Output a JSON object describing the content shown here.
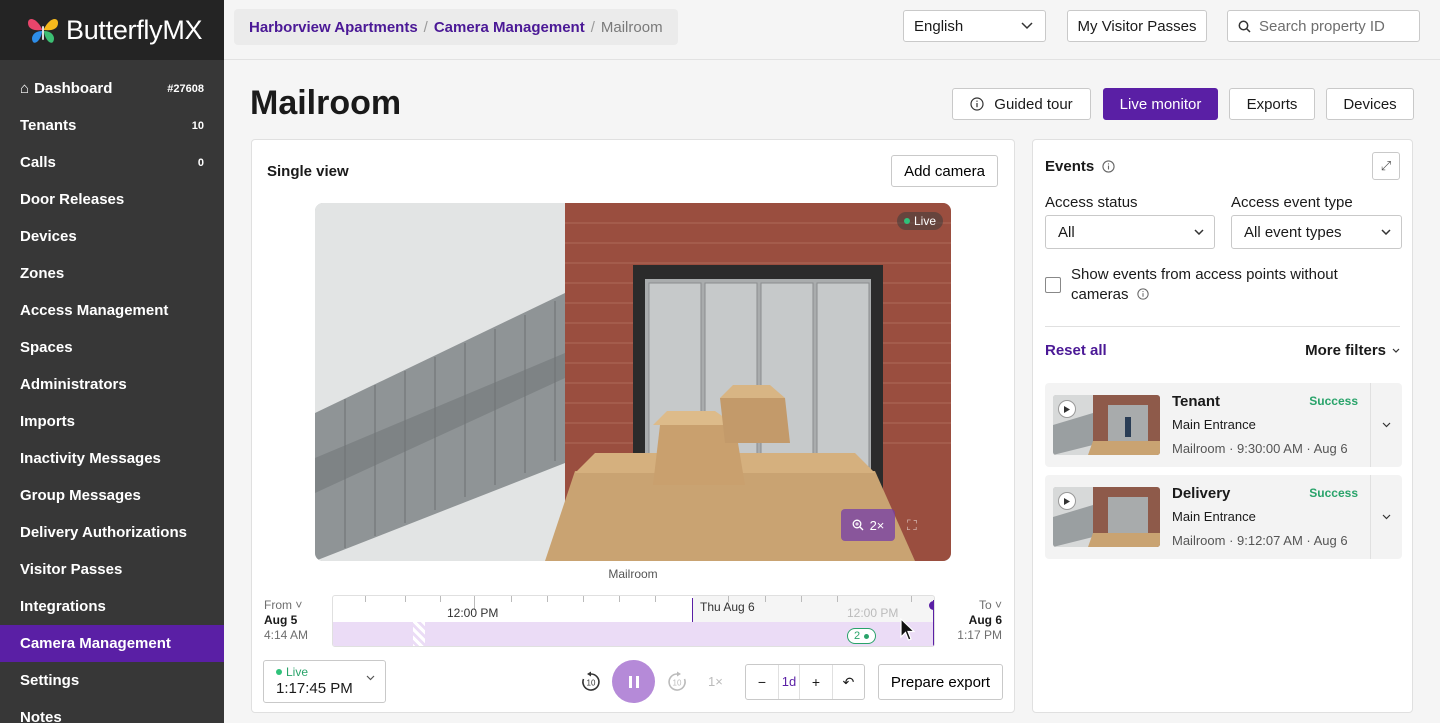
{
  "brand": {
    "name": "ButterflyMX"
  },
  "sidebar": {
    "items": [
      {
        "label": "Dashboard",
        "badge": "#27608"
      },
      {
        "label": "Tenants",
        "badge": "10"
      },
      {
        "label": "Calls",
        "badge": "0"
      },
      {
        "label": "Door Releases",
        "badge": ""
      },
      {
        "label": "Devices",
        "badge": ""
      },
      {
        "label": "Zones",
        "badge": ""
      },
      {
        "label": "Access Management",
        "badge": ""
      },
      {
        "label": "Spaces",
        "badge": ""
      },
      {
        "label": "Administrators",
        "badge": ""
      },
      {
        "label": "Imports",
        "badge": ""
      },
      {
        "label": "Inactivity Messages",
        "badge": ""
      },
      {
        "label": "Group Messages",
        "badge": ""
      },
      {
        "label": "Delivery Authorizations",
        "badge": ""
      },
      {
        "label": "Visitor Passes",
        "badge": ""
      },
      {
        "label": "Integrations",
        "badge": ""
      },
      {
        "label": "Camera Management",
        "badge": ""
      },
      {
        "label": "Settings",
        "badge": ""
      },
      {
        "label": "Notes",
        "badge": ""
      }
    ],
    "active_index": 15
  },
  "topbar": {
    "breadcrumb": [
      "Harborview Apartments",
      "Camera Management",
      "Mailroom"
    ],
    "language": "English",
    "visitor_passes_label": "My Visitor Passes",
    "search_placeholder": "Search property ID"
  },
  "page": {
    "title": "Mailroom",
    "buttons": {
      "guided_tour": "Guided tour",
      "live_monitor": "Live monitor",
      "exports": "Exports",
      "devices": "Devices"
    }
  },
  "camera": {
    "view_title": "Single view",
    "add_camera_label": "Add camera",
    "live_badge": "Live",
    "zoom_label": "2×",
    "caption": "Mailroom",
    "timeline": {
      "from_label": "From",
      "from_date": "Aug 5",
      "from_time": "4:14 AM",
      "to_label": "To",
      "to_date": "Aug 6",
      "to_time": "1:17 PM",
      "label_noon1": "12:00 PM",
      "label_day": "Thu Aug 6",
      "label_noon2": "12:00 PM",
      "event_count": "2"
    },
    "controls": {
      "live_label": "Live",
      "live_time": "1:17:45 PM",
      "speed": "1×",
      "zoom_value": "1d",
      "zoom_minus": "−",
      "zoom_plus": "+",
      "prepare_export": "Prepare export"
    }
  },
  "events": {
    "title": "Events",
    "access_status_label": "Access status",
    "access_status_value": "All",
    "event_type_label": "Access event type",
    "event_type_value": "All event types",
    "checkbox_label": "Show events from access points without cameras",
    "reset_label": "Reset all",
    "more_filters_label": "More filters",
    "items": [
      {
        "name": "Tenant",
        "status": "Success",
        "location": "Main Entrance",
        "meta": "Mailroom · 9:30:00 AM · Aug 6"
      },
      {
        "name": "Delivery",
        "status": "Success",
        "location": "Main Entrance",
        "meta": "Mailroom · 9:12:07 AM · Aug 6"
      }
    ]
  },
  "colors": {
    "accent": "#5a1fa5",
    "sidebar": "#373737",
    "success": "#29a36a",
    "link": "#4b1996"
  }
}
